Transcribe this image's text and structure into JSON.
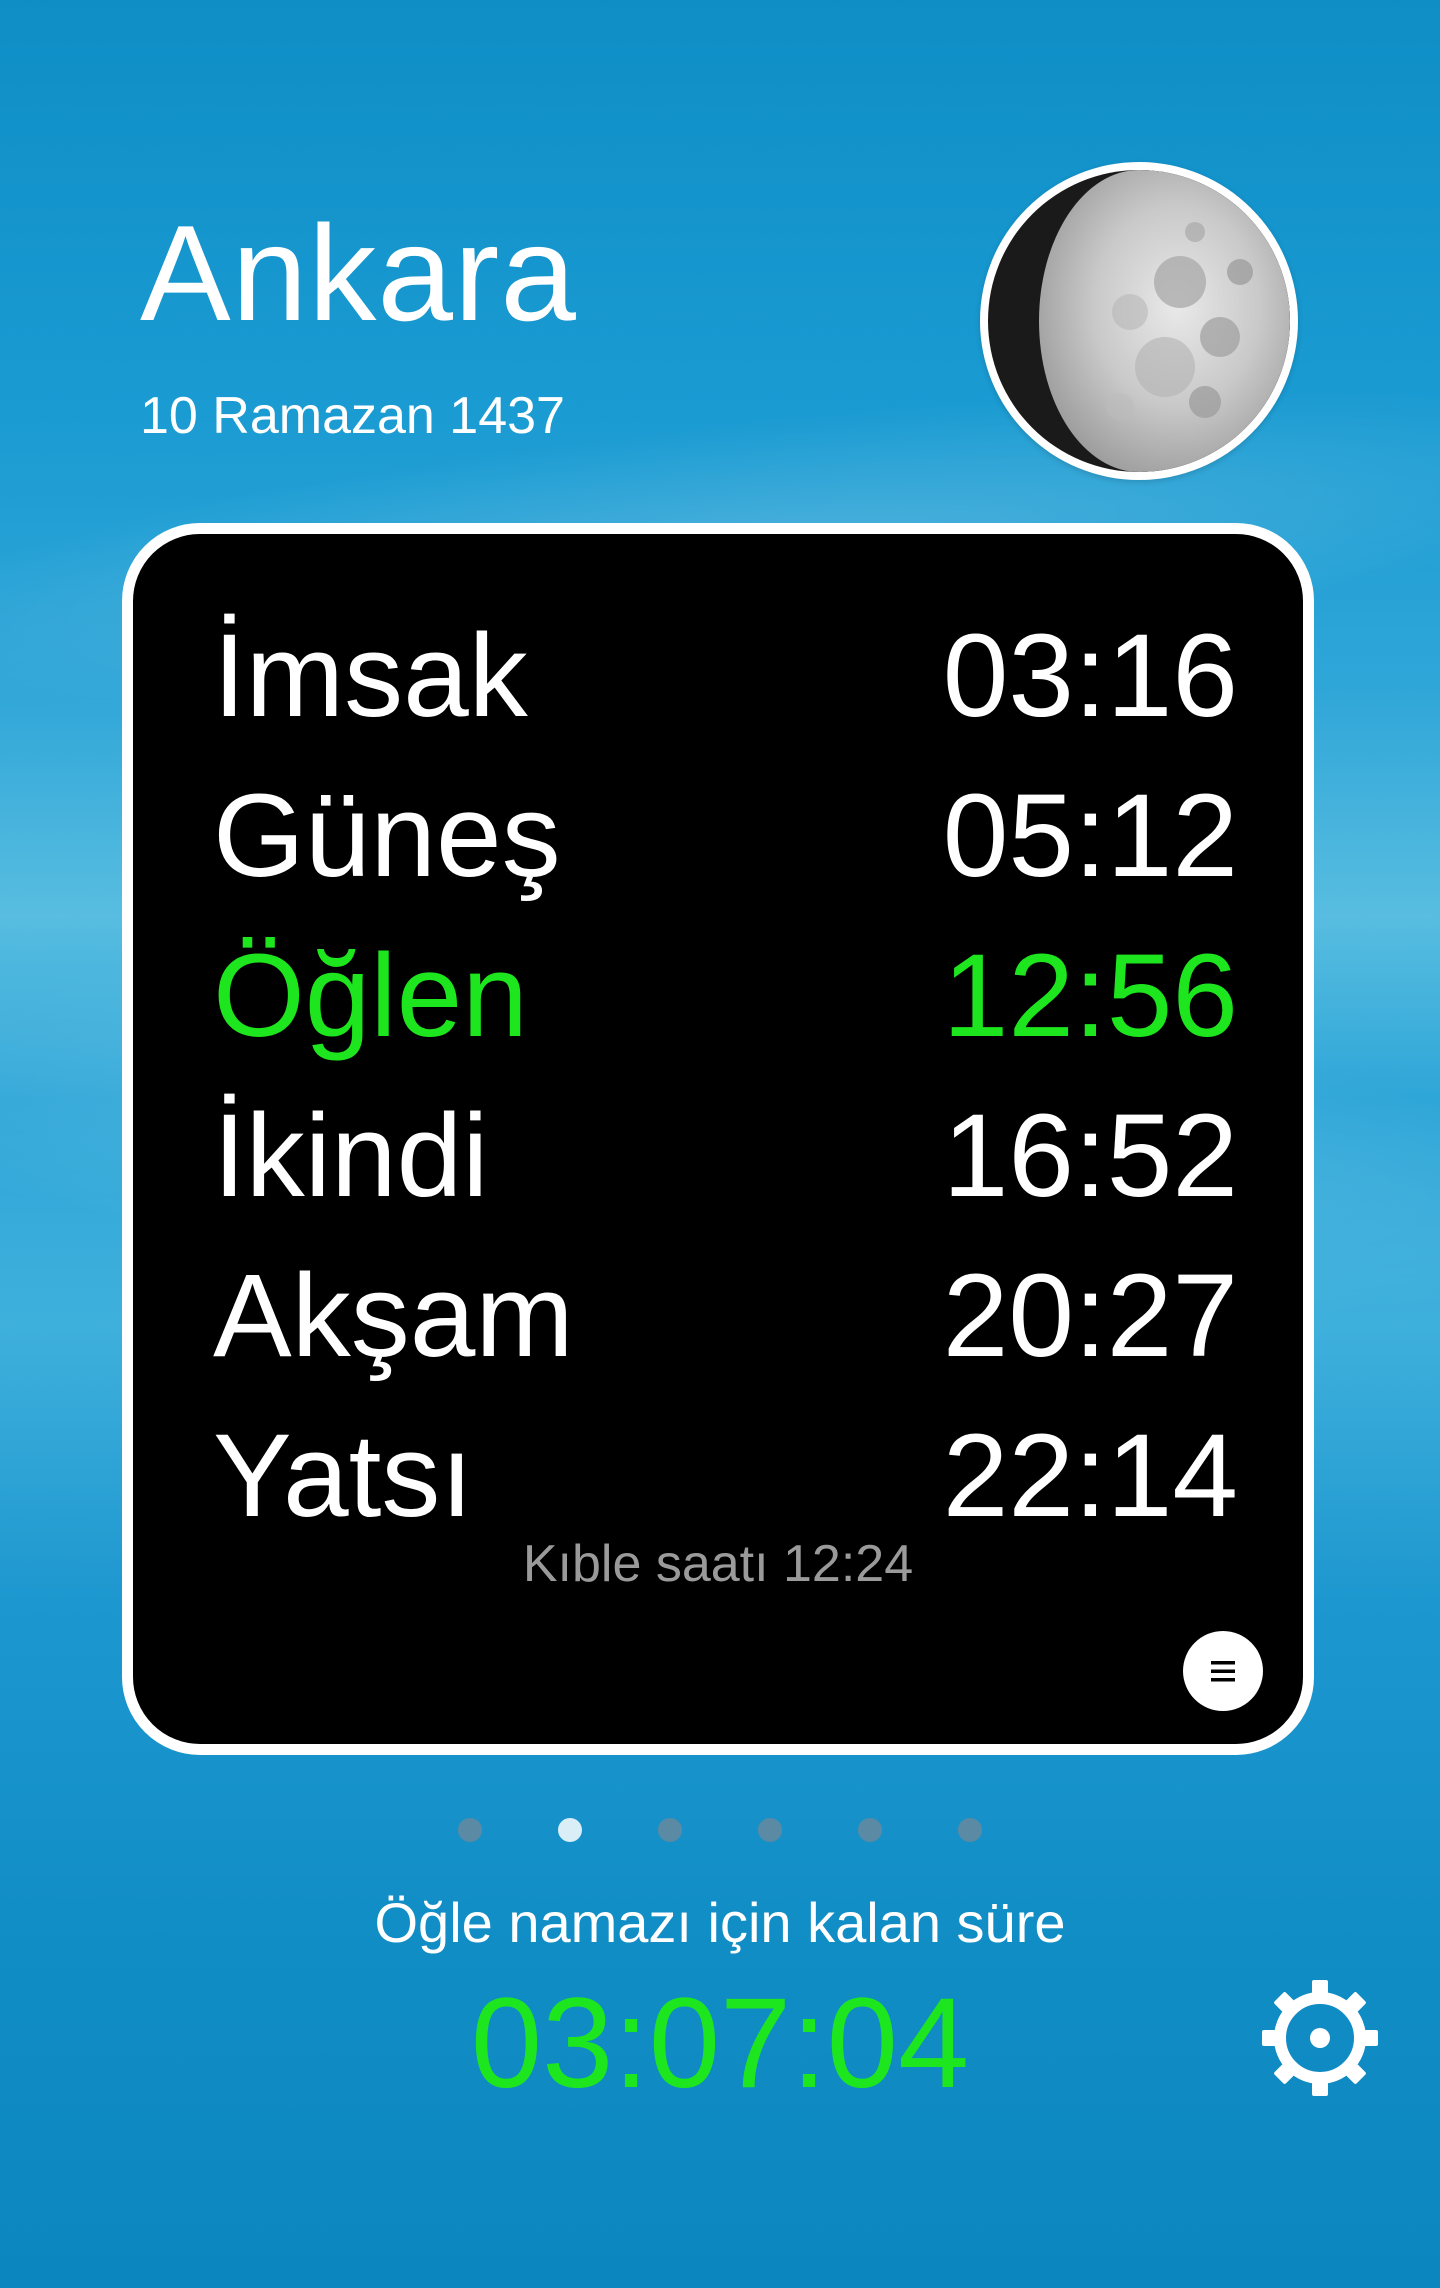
{
  "header": {
    "city": "Ankara",
    "hijri_date": "10 Ramazan 1437"
  },
  "moon": {
    "icon": "moon-phase-icon",
    "phase": "waxing-gibbous"
  },
  "prayers": [
    {
      "name": "İmsak",
      "time": "03:16",
      "active": false
    },
    {
      "name": "Güneş",
      "time": "05:12",
      "active": false
    },
    {
      "name": "Öğlen",
      "time": "12:56",
      "active": true
    },
    {
      "name": "İkindi",
      "time": "16:52",
      "active": false
    },
    {
      "name": "Akşam",
      "time": "20:27",
      "active": false
    },
    {
      "name": "Yatsı",
      "time": "22:14",
      "active": false
    }
  ],
  "qibla": {
    "text": "Kıble saatı 12:24"
  },
  "menu_button": {
    "icon": "menu-icon"
  },
  "pagination": {
    "count": 6,
    "active_index": 1
  },
  "countdown": {
    "label": "Öğle namazı için kalan süre",
    "value": "03:07:04"
  },
  "settings_button": {
    "icon": "gear-icon"
  },
  "colors": {
    "active_prayer": "#1ee61e",
    "card_background": "#000000",
    "card_border": "#ffffff",
    "background_blue": "#1a9bd2",
    "muted_text": "#9a9a9a"
  }
}
